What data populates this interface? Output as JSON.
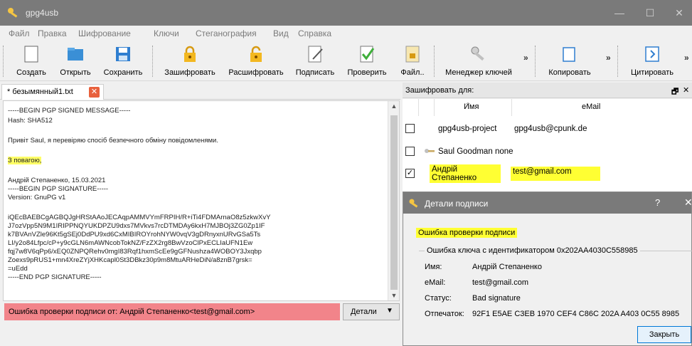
{
  "window": {
    "title": "gpg4usb",
    "min": "—",
    "max": "☐",
    "close": "✕"
  },
  "menu": [
    "Файл",
    "Правка",
    "Шифрование",
    "Ключи",
    "Стеганография",
    "Вид",
    "Справка"
  ],
  "toolbar": {
    "create": "Создать",
    "open": "Открыть",
    "save": "Сохранить",
    "encrypt": "Зашифровать",
    "decrypt": "Расшифровать",
    "sign": "Подписать",
    "verify": "Проверить",
    "file": "Файл..",
    "keymgr": "Менеджер ключей",
    "copy": "Копировать",
    "quote": "Цитировать",
    "more": "»"
  },
  "tab": {
    "label": "* безымянный1.txt",
    "close": "✕"
  },
  "editor": {
    "lines": [
      "-----BEGIN PGP SIGNED MESSAGE-----",
      "Hash: SHA512",
      "",
      "Привіт Saul, я перевіряю спосіб безпечного обміну повідомленями.",
      "",
      "З повагою,",
      "",
      "Андрій Степаненко, 15.03.2021",
      "-----BEGIN PGP SIGNATURE-----",
      "Version: GnuPG v1",
      "",
      "iQEcBAEBCgAGBQJgHRStAAoJECAqpAMMVYmFRPIH/R+iTi4FDMArnaO8z5zkwXvY",
      "J7ozVpp5N9M1IRIPPNQYUKDPZU9dxs7MVkvs7rcDTMDAy6kxH7MJBOj3ZG0Zp1IF",
      "k7BVAnVZle96Kt5gSEj0DdPU9xd6CxMIBIROYrohNYW0vqV3gDRnyxnURvGSa5Ts",
      "LI/y2o84Lfpc/cP+y9cGLN6mAWNcobTokNZ/FzZX2rg8BwVzoClPxECLIaUFN1Ew",
      "fqj7w8V6qPp6/xEQ0ZNPQRehv0mgI83Rqf1hxmScEe9gGFNushza4WOBOY3Jxqbp",
      "Zoexs9pRUS1+mn4XreZYjXHKcapl0St3DBkz30p9m8MtuARHeDiN/a8znB7grsk=",
      "=uEdd",
      "-----END PGP SIGNATURE-----"
    ],
    "highlight_line": 5
  },
  "status": {
    "error": "Ошибка проверки подписи от: Андрій Степаненко<test@gmail.com>",
    "details": "Детали",
    "dropdown": "▼"
  },
  "recipients": {
    "title": "Зашифровать для:",
    "float": "🗗",
    "close": "✕",
    "col_name": "Имя",
    "col_email": "eMail",
    "rows": [
      {
        "name": "gpg4usb-project",
        "email": "gpg4usb@cpunk.de",
        "checked": ""
      },
      {
        "name": "Saul Goodman",
        "email": "none",
        "checked": ""
      },
      {
        "name": "Андрій Степаненко",
        "email": "test@gmail.com",
        "checked": "✓"
      }
    ]
  },
  "dialog": {
    "title": "Детали подписи",
    "help": "?",
    "close": "✕",
    "error": "Ошибка проверки подписи",
    "group": "Ошибка ключа с идентификатором 0x202AA4030C558985",
    "name_label": "Имя:",
    "name": "Андрій Степаненко",
    "email_label": "eMail:",
    "email": "test@gmail.com",
    "status_label": "Статус:",
    "status": "Bad signature",
    "fp_label": "Отпечаток:",
    "fingerprint": "92F1 E5AE C3EB 1970 CEF4 C86C 202A A403 0C55 8985",
    "close_btn": "Закрыть"
  },
  "colors": {
    "highlight": "#ffff33",
    "error_bar": "#f2848a",
    "titlebar": "#7a7a7a"
  }
}
